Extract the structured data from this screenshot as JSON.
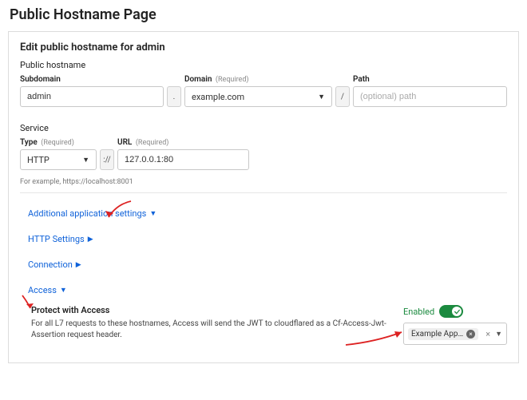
{
  "page": {
    "title": "Public Hostname Page"
  },
  "panel": {
    "title": "Edit public hostname for admin"
  },
  "hostname": {
    "section_label": "Public hostname",
    "subdomain": {
      "label": "Subdomain",
      "value": "admin"
    },
    "joiner_dot": ".",
    "domain": {
      "label": "Domain",
      "required": "(Required)",
      "value": "example.com"
    },
    "joiner_slash": "/",
    "path": {
      "label": "Path",
      "placeholder": "(optional) path",
      "value": ""
    }
  },
  "service": {
    "section_label": "Service",
    "type": {
      "label": "Type",
      "required": "(Required)",
      "value": "HTTP"
    },
    "joiner_scheme": "://",
    "url": {
      "label": "URL",
      "required": "(Required)",
      "value": "127.0.0.1:80"
    },
    "hint": "For example, https://localhost:8001"
  },
  "links": {
    "additional": "Additional application settings",
    "http": "HTTP Settings",
    "connection": "Connection",
    "access": "Access"
  },
  "access_panel": {
    "title": "Protect with Access",
    "desc": "For all L7 requests to these hostnames, Access will send the JWT to cloudflared as a Cf-Access-Jwt-Assertion request header.",
    "enabled_label": "Enabled",
    "enabled": true,
    "apps": [
      "Example Applicati…"
    ]
  }
}
